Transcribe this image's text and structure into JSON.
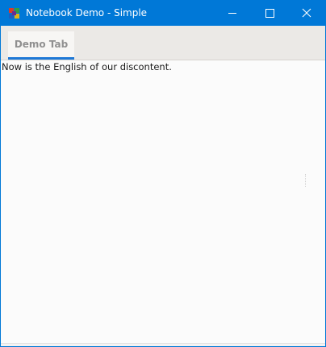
{
  "window": {
    "title": "Notebook Demo - Simple",
    "accent_color": "#0078d7",
    "app_icon": "colored-cube-app-icon",
    "controls": {
      "minimize_icon": "minimize-icon",
      "maximize_icon": "maximize-icon",
      "close_icon": "close-icon"
    }
  },
  "notebook": {
    "tabs": [
      {
        "label": "Demo Tab",
        "selected": true
      }
    ],
    "indicator_color": "#1e78d6"
  },
  "content": {
    "text": "Now is the English of our discontent."
  }
}
